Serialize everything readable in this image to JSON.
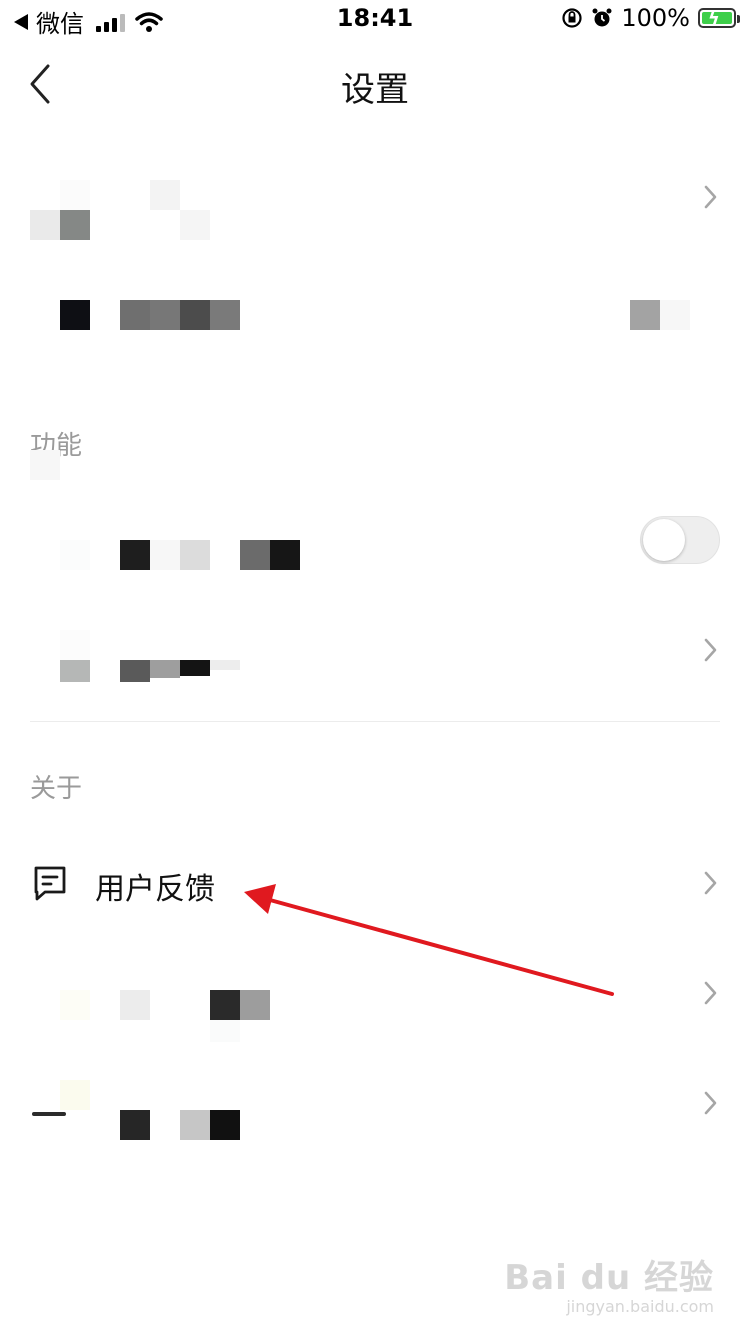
{
  "status_bar": {
    "carrier": "微信",
    "time": "18:41",
    "battery": "100%",
    "battery_level": 1.0
  },
  "nav": {
    "title": "设置",
    "back_icon": "chevron-left-icon"
  },
  "sections": {
    "function_label": "功能",
    "about_label": "关于"
  },
  "rows": {
    "feedback_label": "用户反馈",
    "feedback_icon": "feedback-message-icon"
  },
  "toggle": {
    "on": false
  },
  "colors": {
    "annotation_arrow": "#e0191f",
    "battery_fill": "#3ecf4a",
    "section_text": "#9a9a9a"
  },
  "watermark": {
    "main": "Bai du 经验",
    "sub": "jingyan.baidu.com"
  }
}
